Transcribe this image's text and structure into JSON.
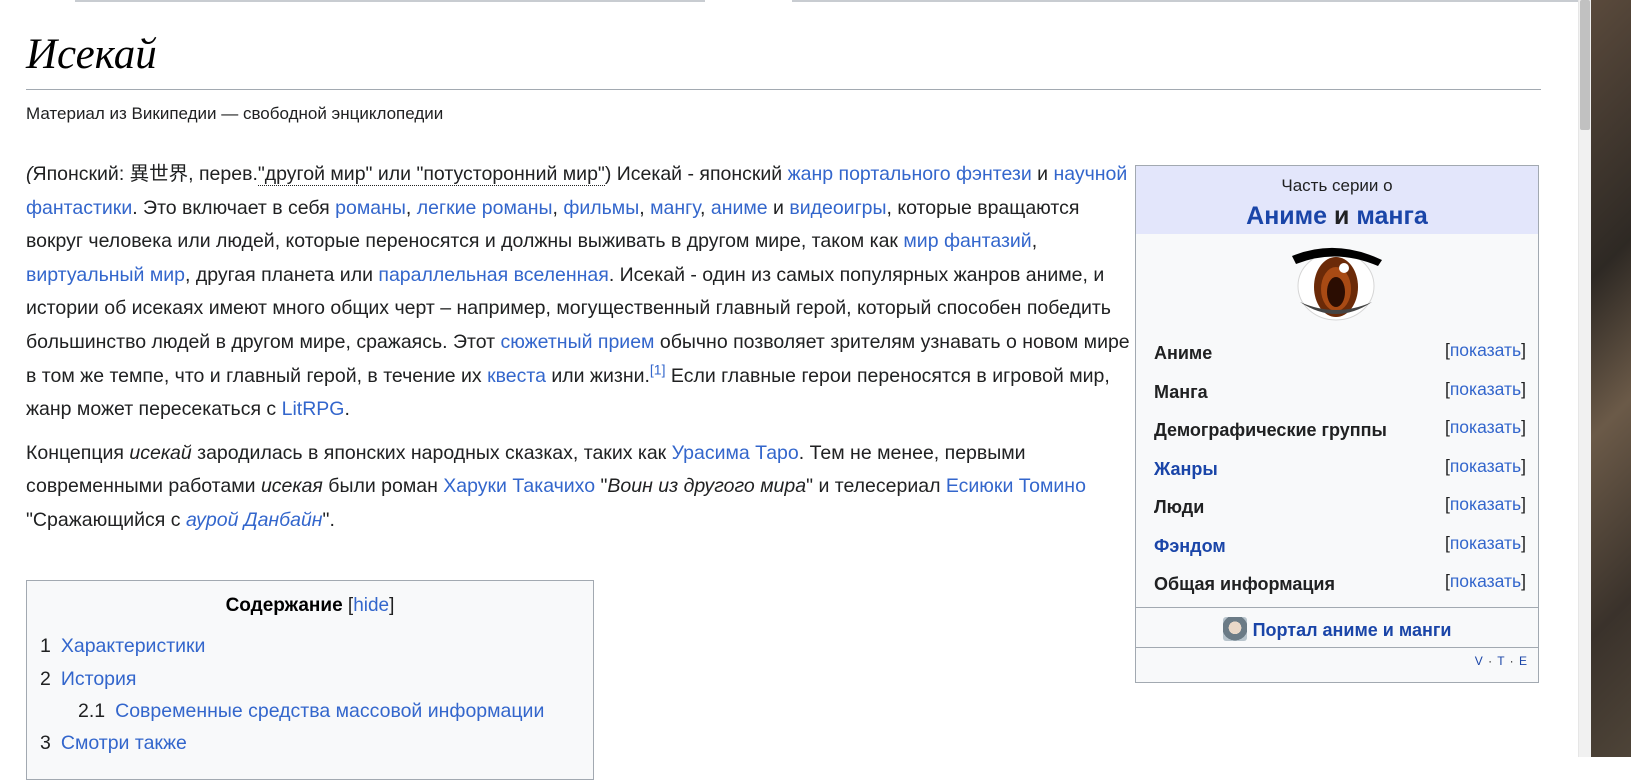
{
  "page": {
    "title": "Исекай",
    "tagline": "Материал из Википедии — свободной энциклопедии"
  },
  "paragraph1": {
    "open": "(",
    "lang": "Японский: 異世界, перев.",
    "translation": "\"другой мир\" или \"потусторонний мир\"",
    "t1": ") Исекай - японский ",
    "l_portal": "жанр портального фэнтези",
    "t2": " и ",
    "l_scifi": "научной фантастики",
    "t3": ". Это включает в себя ",
    "l_novels": "романы",
    "c1": ", ",
    "l_light": "легкие романы",
    "c2": ", ",
    "l_films": "фильмы",
    "c3": ", ",
    "l_manga": "мангу",
    "c4": ", ",
    "l_anime": "аниме",
    "t4": " и ",
    "l_games": "видеоигры",
    "t5": ", которые вращаются вокруг человека или людей, которые переносятся и должны выживать в другом мире, таком как ",
    "l_fantasy": "мир фантазий",
    "c5": ", ",
    "l_virtual": "виртуальный мир",
    "t6": ", другая планета или ",
    "l_parallel": "параллельная вселенная",
    "t7": ". Исекай - один из самых популярных жанров аниме, и истории об исекаях имеют много общих черт – например, могущественный главный герой, который способен победить большинство людей в другом мире, сражаясь. Этот ",
    "l_plot": "сюжетный прием",
    "t8": " обычно позволяет зрителям узнавать о новом мире в том же темпе, что и главный герой, в течение их ",
    "l_quest": "квеста",
    "t9": " или жизни.",
    "ref": "[1]",
    "t10": " Если главные герои переносятся в игровой мир, жанр может пересекаться с ",
    "l_litrpg": "LitRPG",
    "t11": "."
  },
  "paragraph2": {
    "t1": "Концепция ",
    "i1": "исекай",
    "t2": " зародилась в японских народных сказках, таких как ",
    "l_urashima": "Урасима Таро",
    "t3": ". Тем не менее, первыми современными работами ",
    "i2": "исекая",
    "t4": " были роман ",
    "l_haruki": "Харуки Такачихо",
    "t5": " \"",
    "i3": "Воин из другого мира",
    "t6": "\" и телесериал ",
    "l_tomino": "Есиюки Томино",
    "t7": " \"Сражающийся с ",
    "l_dunbine": "аурой Данбайн",
    "t8": "\"."
  },
  "infobox": {
    "pre": "Часть серии о",
    "title_a": "Аниме",
    "title_and": " и ",
    "title_b": "манга",
    "rows": [
      {
        "label": "Аниме",
        "action": "показать"
      },
      {
        "label": "Манга",
        "action": "показать"
      },
      {
        "label": "Демографические группы",
        "action": "показать"
      },
      {
        "label": "Жанры",
        "action": "показать"
      },
      {
        "label": "Люди",
        "action": "показать"
      },
      {
        "label": "Фэндом",
        "action": "показать"
      },
      {
        "label": "Общая информация",
        "action": "показать"
      }
    ],
    "portal": "Портал аниме и манги",
    "vte": [
      "V",
      "T",
      "E"
    ]
  },
  "toc": {
    "title": "Содержание",
    "hide": "hide",
    "items": [
      {
        "num": "1",
        "label": "Характеристики"
      },
      {
        "num": "2",
        "label": "История"
      },
      {
        "num": "2.1",
        "label": "Современные средства массовой информации"
      },
      {
        "num": "3",
        "label": "Смотри также"
      }
    ]
  },
  "colors": {
    "link": "#3366cc",
    "infobox_header": "#e3e6fb",
    "border": "#a2a9b1"
  }
}
